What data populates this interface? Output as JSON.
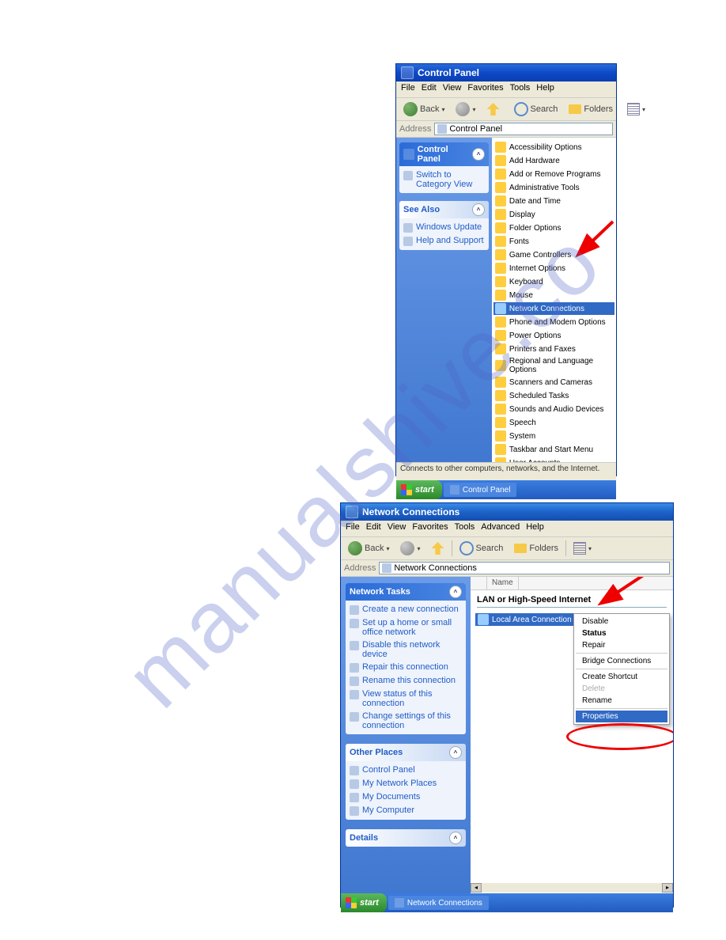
{
  "watermark": "manualshive.co",
  "shot1": {
    "title": "Control Panel",
    "menus": [
      "File",
      "Edit",
      "View",
      "Favorites",
      "Tools",
      "Help"
    ],
    "toolbar": {
      "back": "Back",
      "search": "Search",
      "folders": "Folders"
    },
    "address_label": "Address",
    "address_value": "Control Panel",
    "panel_cp_title": "Control Panel",
    "switch_link": "Switch to Category View",
    "see_also_title": "See Also",
    "see_also_links": [
      "Windows Update",
      "Help and Support"
    ],
    "items": [
      "Accessibility Options",
      "Add Hardware",
      "Add or Remove Programs",
      "Administrative Tools",
      "Date and Time",
      "Display",
      "Folder Options",
      "Fonts",
      "Game Controllers",
      "Internet Options",
      "Keyboard",
      "Mouse",
      "Network Connections",
      "Phone and Modem Options",
      "Power Options",
      "Printers and Faxes",
      "Regional and Language Options",
      "Scanners and Cameras",
      "Scheduled Tasks",
      "Sounds and Audio Devices",
      "Speech",
      "System",
      "Taskbar and Start Menu",
      "User Accounts"
    ],
    "selected_index": 12,
    "status": "Connects to other computers, networks, and the Internet.",
    "start": "start",
    "taskbtn": "Control Panel"
  },
  "shot2": {
    "title": "Network Connections",
    "menus": [
      "File",
      "Edit",
      "View",
      "Favorites",
      "Tools",
      "Advanced",
      "Help"
    ],
    "toolbar": {
      "back": "Back",
      "search": "Search",
      "folders": "Folders"
    },
    "address_label": "Address",
    "address_value": "Network Connections",
    "tasks_title": "Network Tasks",
    "tasks": [
      "Create a new connection",
      "Set up a home or small office network",
      "Disable this network device",
      "Repair this connection",
      "Rename this connection",
      "View status of this connection",
      "Change settings of this connection"
    ],
    "other_title": "Other Places",
    "other_links": [
      "Control Panel",
      "My Network Places",
      "My Documents",
      "My Computer"
    ],
    "details_title": "Details",
    "col_name": "Name",
    "group": "LAN or High-Speed Internet",
    "conn": "Local Area Connection",
    "ctx": [
      "Disable",
      "Status",
      "Repair",
      "Bridge Connections",
      "Create Shortcut",
      "Delete",
      "Rename",
      "Properties"
    ],
    "start": "start",
    "taskbtn": "Network Connections"
  }
}
